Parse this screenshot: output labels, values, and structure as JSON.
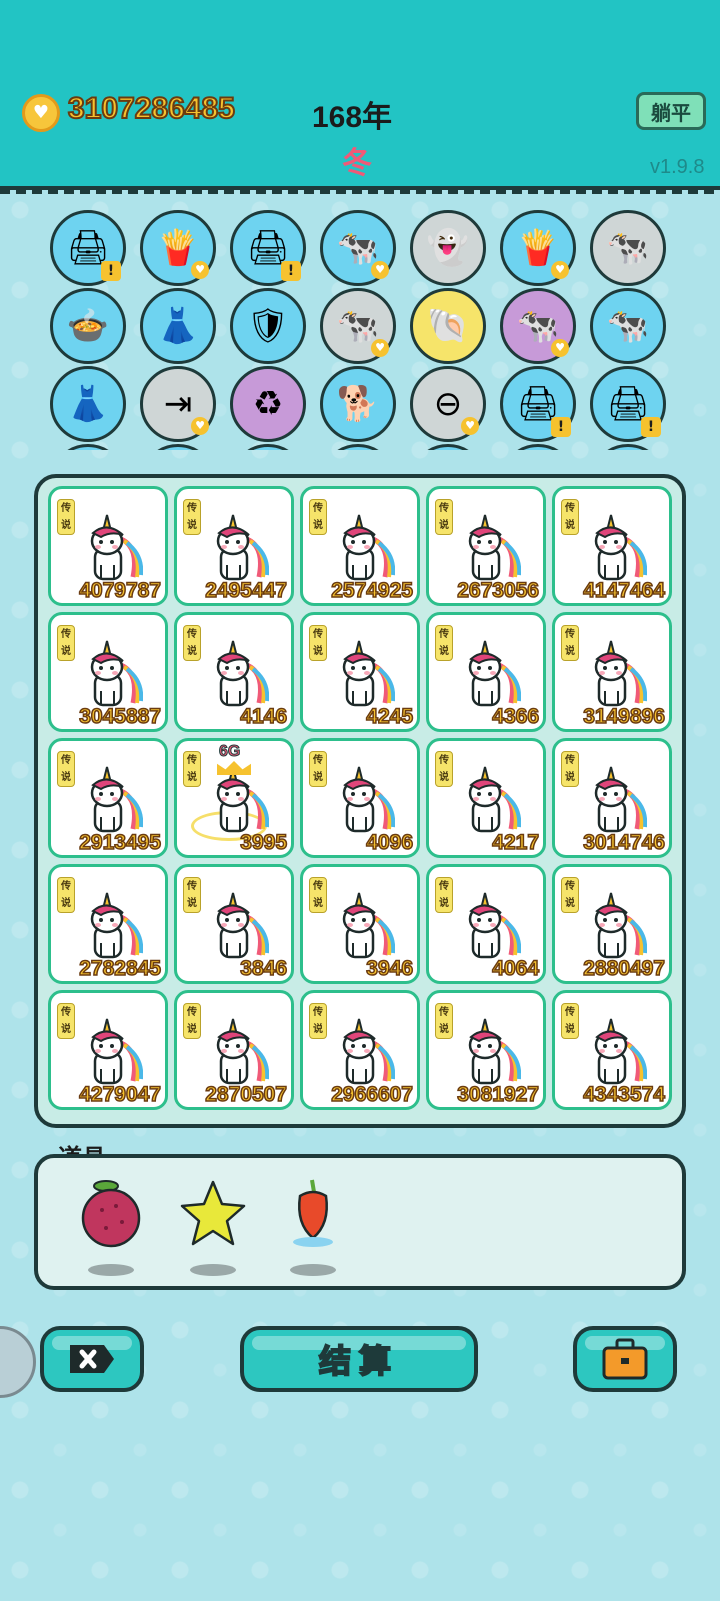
{
  "header": {
    "coins": "3107286485",
    "year": "168年",
    "season": "冬",
    "lie_flat_label": "躺平",
    "version": "v1.9.8"
  },
  "top_icons": [
    {
      "name": "printer",
      "bg": "#6ed3f0",
      "glyph": "🖨",
      "badge": "warn"
    },
    {
      "name": "fries",
      "bg": "#6ed3f0",
      "glyph": "🍟",
      "badge": "heart"
    },
    {
      "name": "printer",
      "bg": "#6ed3f0",
      "glyph": "🖨",
      "badge": "warn"
    },
    {
      "name": "twin-cows",
      "bg": "#6ed3f0",
      "glyph": "🐄",
      "badge": "heart"
    },
    {
      "name": "ghost",
      "bg": "#cfd6d6",
      "glyph": "👻",
      "badge": ""
    },
    {
      "name": "fries",
      "bg": "#6ed3f0",
      "glyph": "🍟",
      "badge": "heart"
    },
    {
      "name": "twin-cows",
      "bg": "#cfd6d6",
      "glyph": "🐄",
      "badge": ""
    },
    {
      "name": "duck-pot",
      "bg": "#6ed3f0",
      "glyph": "🍲",
      "badge": ""
    },
    {
      "name": "skirt",
      "bg": "#6ed3f0",
      "glyph": "👗",
      "badge": ""
    },
    {
      "name": "shield",
      "bg": "#6ed3f0",
      "glyph": "🛡",
      "badge": ""
    },
    {
      "name": "twin-cows",
      "bg": "#cfd6d6",
      "glyph": "🐄",
      "badge": "heart"
    },
    {
      "name": "shell",
      "bg": "#f6e46a",
      "glyph": "🐚",
      "badge": ""
    },
    {
      "name": "twin-cows",
      "bg": "#c79ad8",
      "glyph": "🐄",
      "badge": "heart"
    },
    {
      "name": "twin-cows",
      "bg": "#6ed3f0",
      "glyph": "🐄",
      "badge": ""
    },
    {
      "name": "skirt",
      "bg": "#6ed3f0",
      "glyph": "👗",
      "badge": ""
    },
    {
      "name": "skip",
      "bg": "#cfd6d6",
      "glyph": "⇥",
      "badge": "heart"
    },
    {
      "name": "recycle",
      "bg": "#c79ad8",
      "glyph": "♻",
      "badge": ""
    },
    {
      "name": "cool-dog",
      "bg": "#6ed3f0",
      "glyph": "🐕",
      "badge": ""
    },
    {
      "name": "minus",
      "bg": "#cfd6d6",
      "glyph": "⊖",
      "badge": "heart"
    },
    {
      "name": "printer",
      "bg": "#6ed3f0",
      "glyph": "🖨",
      "badge": "warn"
    },
    {
      "name": "printer",
      "bg": "#6ed3f0",
      "glyph": "🖨",
      "badge": "warn"
    }
  ],
  "board": {
    "tag": "传说",
    "cells": [
      {
        "value": "4079787"
      },
      {
        "value": "2495447"
      },
      {
        "value": "2574925"
      },
      {
        "value": "2673056"
      },
      {
        "value": "4147464"
      },
      {
        "value": "3045887"
      },
      {
        "value": "4146"
      },
      {
        "value": "4245"
      },
      {
        "value": "4366"
      },
      {
        "value": "3149896"
      },
      {
        "value": "2913495"
      },
      {
        "value": "3995",
        "badge": "6G",
        "crowned": true
      },
      {
        "value": "4096"
      },
      {
        "value": "4217"
      },
      {
        "value": "3014746"
      },
      {
        "value": "2782845"
      },
      {
        "value": "3846"
      },
      {
        "value": "3946"
      },
      {
        "value": "4064"
      },
      {
        "value": "2880497"
      },
      {
        "value": "4279047"
      },
      {
        "value": "2870507"
      },
      {
        "value": "2966607"
      },
      {
        "value": "3081927"
      },
      {
        "value": "4343574"
      }
    ]
  },
  "props": {
    "label": "道具",
    "items": [
      {
        "name": "lychee",
        "color": "#c0365e"
      },
      {
        "name": "star",
        "color": "#e8e83a"
      },
      {
        "name": "chili",
        "color": "#e84a2a"
      }
    ]
  },
  "buttons": {
    "settle_label": "结算"
  },
  "colors": {
    "header_bg": "#22c4c4",
    "cell_border": "#2dbf8c",
    "value_text": "#f6c22f"
  }
}
